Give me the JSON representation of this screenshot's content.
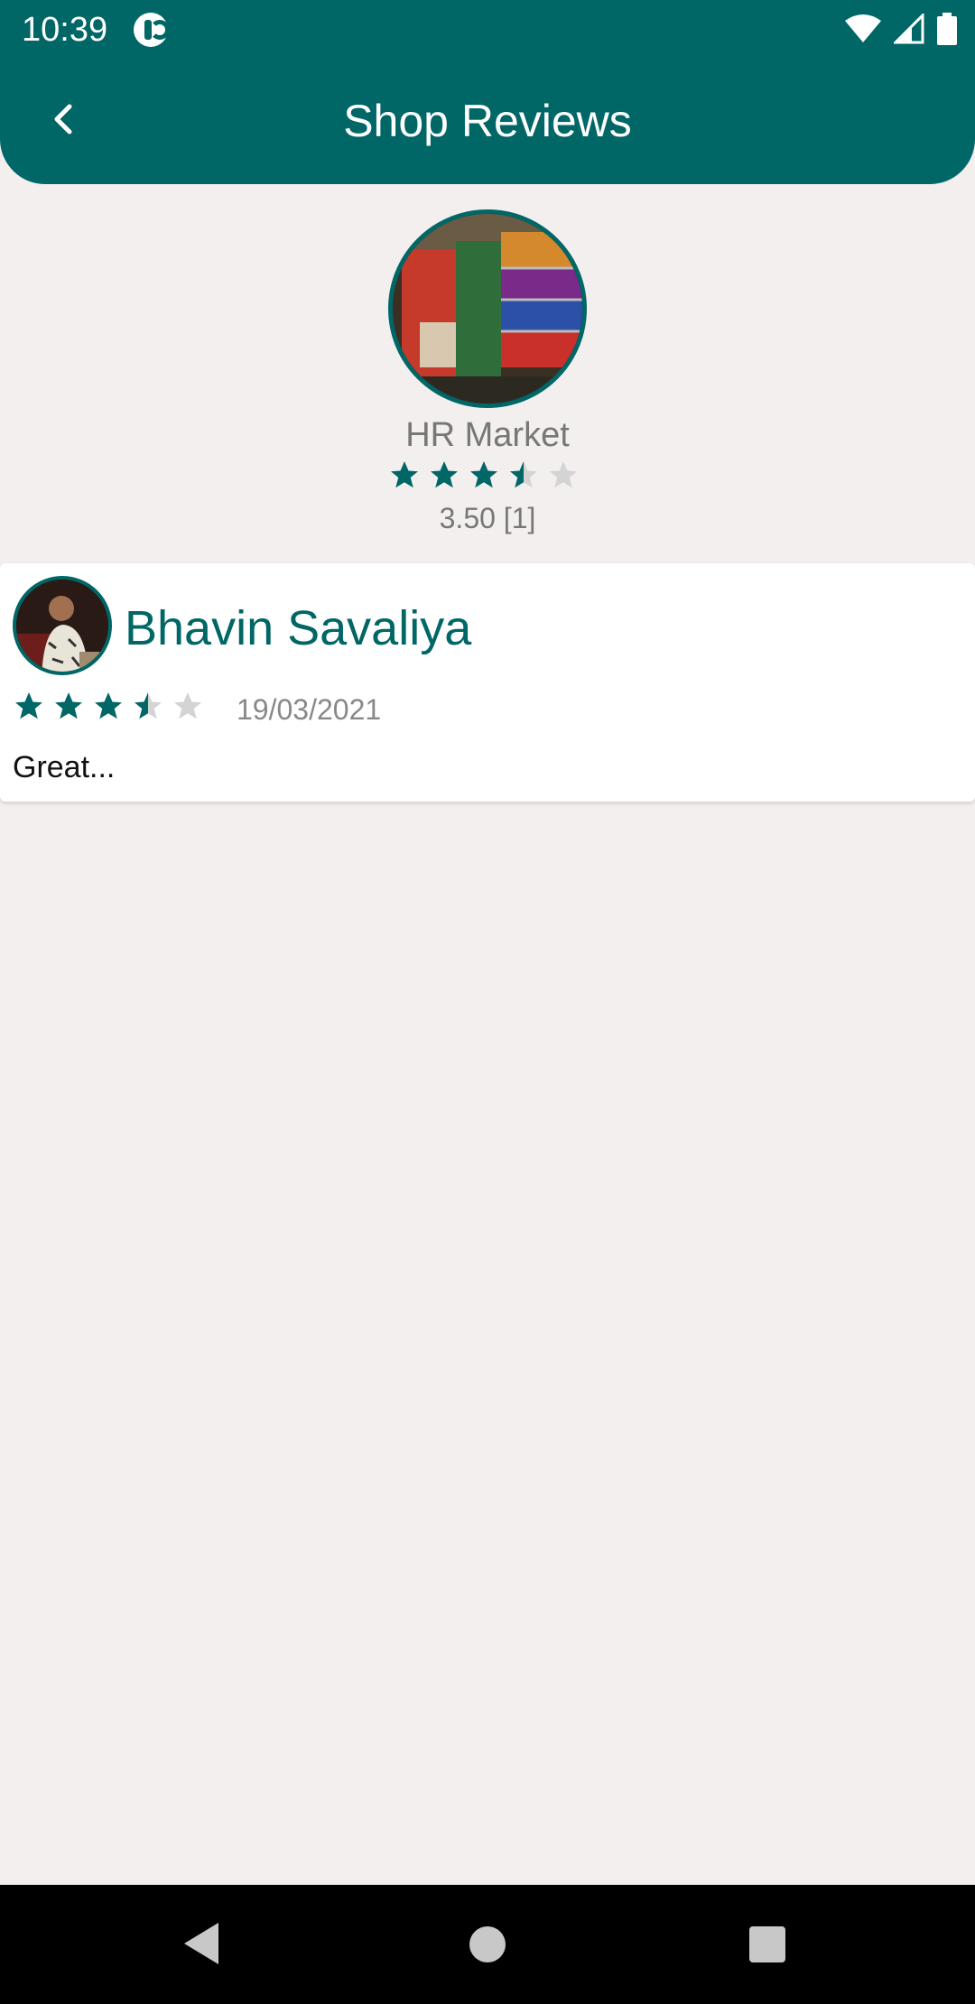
{
  "status_bar": {
    "time": "10:39"
  },
  "header": {
    "title": "Shop Reviews",
    "back_icon": "chevron-left-icon"
  },
  "shop": {
    "name": "HR Market",
    "rating_text": "3.50 [1]",
    "rating_value": 3.5,
    "max_rating": 5
  },
  "reviews": [
    {
      "name": "Bhavin Savaliya",
      "date": "19/03/2021",
      "text": "Great...",
      "rating_value": 3.5
    }
  ],
  "colors": {
    "primary": "#006666",
    "background": "#f3efef",
    "star_filled": "#006666",
    "star_empty": "#d4d4d4"
  }
}
